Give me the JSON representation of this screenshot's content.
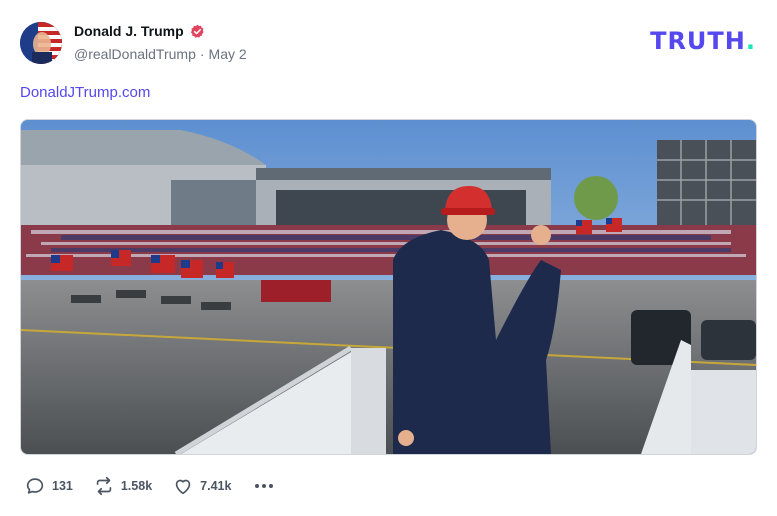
{
  "post": {
    "author": {
      "display_name": "Donald J. Trump",
      "handle": "@realDonaldTrump",
      "separator": "·",
      "date": "May 2",
      "verified": true,
      "avatar_icon": "avatar-flag-portrait"
    },
    "brand_logo": {
      "text": "TRUTH",
      "dot": ".",
      "color": "#5448ee",
      "dot_color": "#17e6b5"
    },
    "link_text": "DonaldJTrump.com",
    "media": {
      "kind": "photo",
      "subject": "rally-crowd-airport-hangar"
    },
    "actions": {
      "reply": {
        "icon": "reply-bubble-icon",
        "count": "131"
      },
      "retruth": {
        "icon": "retruth-icon",
        "count": "1.58k"
      },
      "like": {
        "icon": "heart-icon",
        "count": "7.41k"
      },
      "more_icon": "more-dots-icon"
    }
  }
}
